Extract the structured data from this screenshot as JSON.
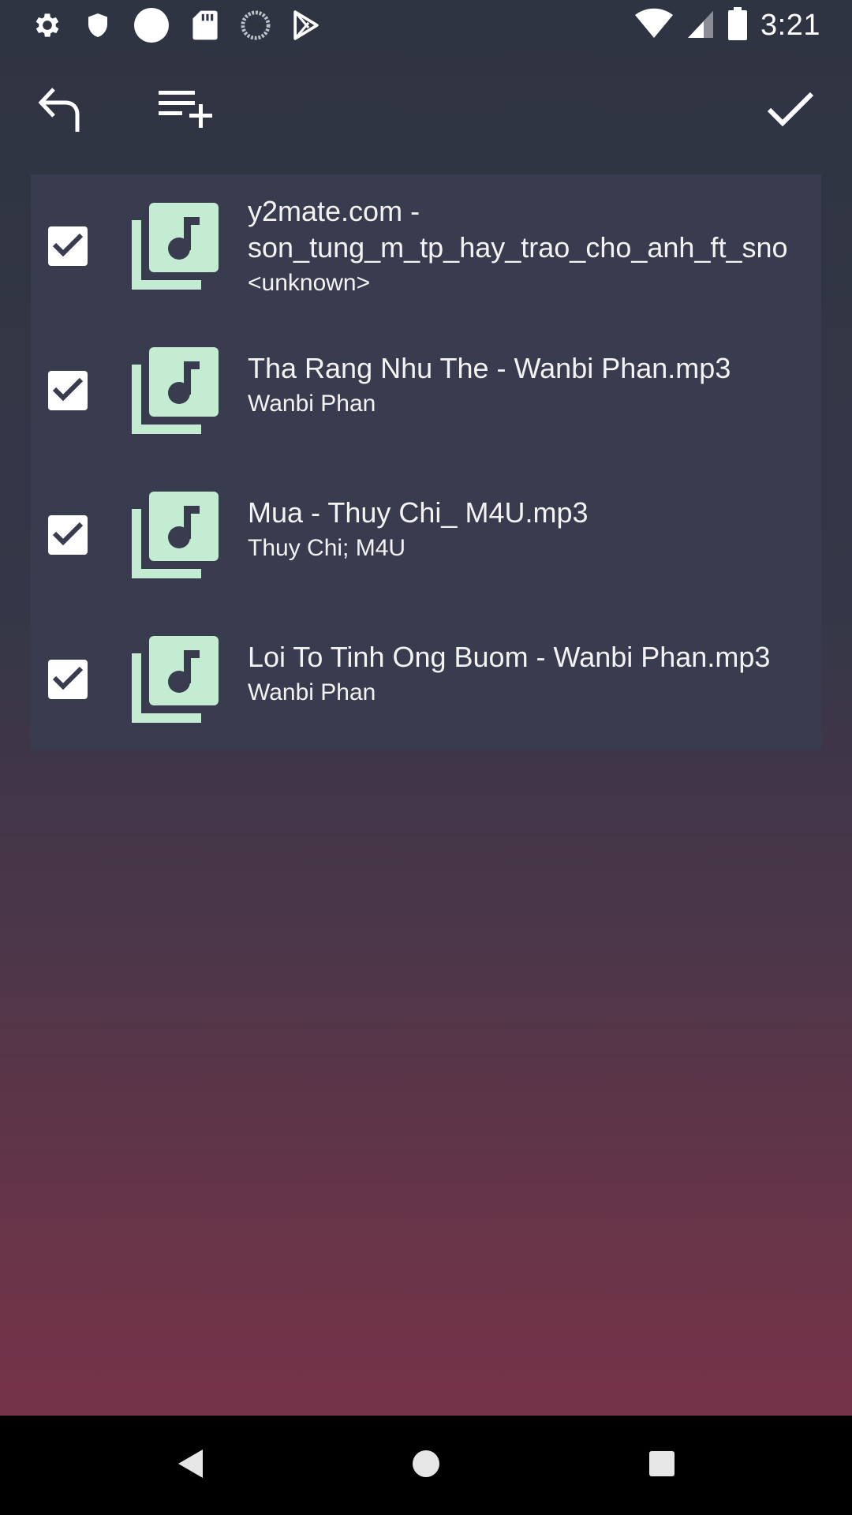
{
  "status_bar": {
    "time": "3:21",
    "left_icons": [
      "settings-icon",
      "shield-icon",
      "circle-icon",
      "sd-card-icon",
      "loading-icon",
      "play-store-icon"
    ],
    "right_icons": [
      "wifi-icon",
      "signal-icon",
      "battery-icon"
    ]
  },
  "toolbar": {
    "icons": [
      "undo-icon",
      "playlist-add-icon",
      "check-icon"
    ]
  },
  "songs": [
    {
      "title": "y2mate.com -\nson_tung_m_tp_hay_trao_cho_anh_ft_sno",
      "artist": "<unknown>",
      "checked": true
    },
    {
      "title": "Tha Rang Nhu The - Wanbi Phan.mp3",
      "artist": "Wanbi Phan",
      "checked": true
    },
    {
      "title": "Mua - Thuy Chi_ M4U.mp3",
      "artist": "Thuy Chi; M4U",
      "checked": true
    },
    {
      "title": "Loi To Tinh Ong Buom - Wanbi Phan.mp3",
      "artist": "Wanbi Phan",
      "checked": true
    }
  ],
  "colors": {
    "icon_accent": "#c3ecd2",
    "card_bg": "#393b4e"
  }
}
